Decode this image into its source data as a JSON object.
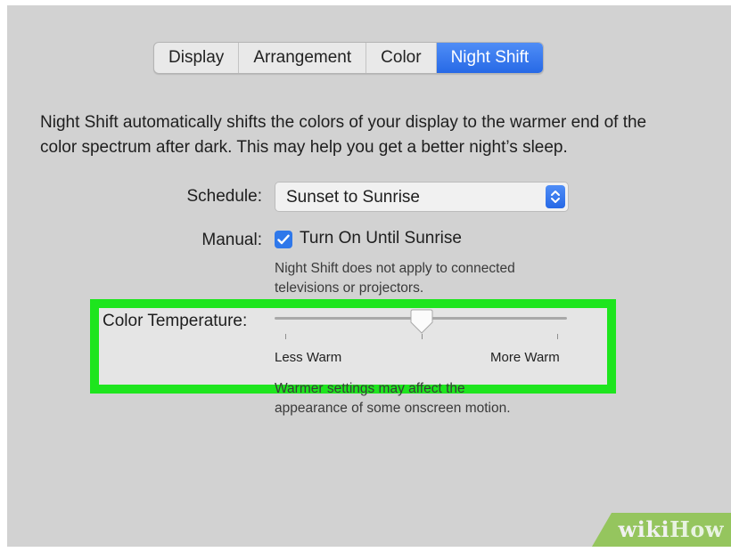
{
  "tabs": [
    {
      "label": "Display",
      "active": false
    },
    {
      "label": "Arrangement",
      "active": false
    },
    {
      "label": "Color",
      "active": false
    },
    {
      "label": "Night Shift",
      "active": true
    }
  ],
  "description": {
    "line1": "Night Shift automatically shifts the colors of your display to the warmer end of the",
    "line2": "color spectrum after dark. This may help you get a better night’s sleep."
  },
  "schedule": {
    "label": "Schedule:",
    "value": "Sunset to Sunrise",
    "icon": "updown-chevron-icon"
  },
  "manual": {
    "label": "Manual:",
    "checkbox_label": "Turn On Until Sunrise",
    "checked": true,
    "note_line1": "Night Shift does not apply to connected",
    "note_line2": "televisions or projectors."
  },
  "color_temperature": {
    "label": "Color Temperature:",
    "min_label": "Less Warm",
    "max_label": "More Warm",
    "value_fraction": 0.5,
    "note_line1": "Warmer settings may affect the",
    "note_line2": "appearance of some onscreen motion."
  },
  "colors": {
    "accent_blue": "#2f78ea",
    "highlight_green": "#1ee51e",
    "panel_gray": "#d2d2d2",
    "watermark_green": "#8bc34a"
  },
  "watermark": {
    "part1": "wiki",
    "part2": "How"
  }
}
